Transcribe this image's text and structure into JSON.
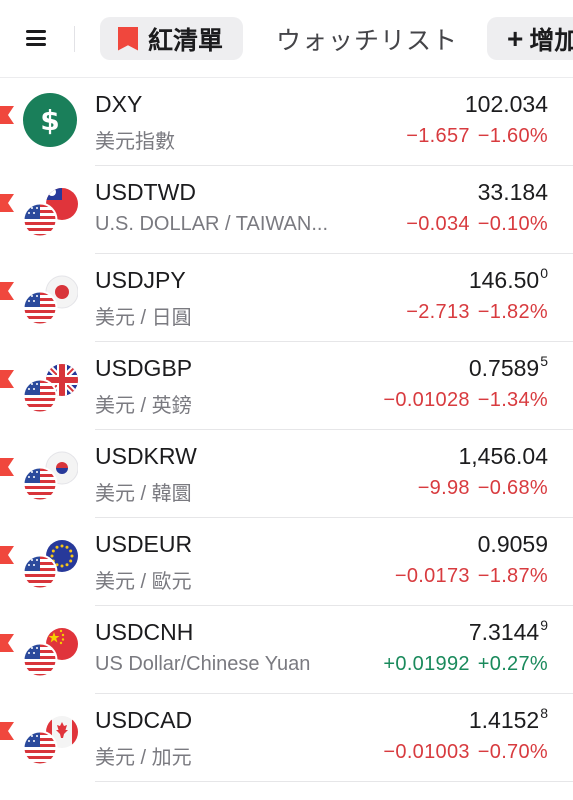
{
  "header": {
    "tabs": [
      {
        "label": "紅清單",
        "active": true
      },
      {
        "label": "ウォッチリスト",
        "active": false
      },
      {
        "label": "增加",
        "active": false
      }
    ]
  },
  "colors": {
    "accent": "#f0473d",
    "negative": "#d83b3f",
    "positive": "#1a8a5c"
  },
  "rows": [
    {
      "symbol": "DXY",
      "name": "美元指數",
      "price": "102.034",
      "price_sup": "",
      "change": "−1.657",
      "pct": "−1.60%",
      "direction": "down",
      "icon": "dollar-index-icon"
    },
    {
      "symbol": "USDTWD",
      "name": "U.S. DOLLAR / TAIWAN...",
      "price": "33.184",
      "price_sup": "",
      "change": "−0.034",
      "pct": "−0.10%",
      "direction": "down",
      "icon": "us-tw-flags-icon"
    },
    {
      "symbol": "USDJPY",
      "name": "美元 / 日圓",
      "price": "146.50",
      "price_sup": "0",
      "change": "−2.713",
      "pct": "−1.82%",
      "direction": "down",
      "icon": "us-jp-flags-icon"
    },
    {
      "symbol": "USDGBP",
      "name": "美元 / 英鎊",
      "price": "0.7589",
      "price_sup": "5",
      "change": "−0.01028",
      "pct": "−1.34%",
      "direction": "down",
      "icon": "us-gb-flags-icon"
    },
    {
      "symbol": "USDKRW",
      "name": "美元 / 韓圜",
      "price": "1,456.04",
      "price_sup": "",
      "change": "−9.98",
      "pct": "−0.68%",
      "direction": "down",
      "icon": "us-kr-flags-icon"
    },
    {
      "symbol": "USDEUR",
      "name": "美元 / 歐元",
      "price": "0.9059",
      "price_sup": "",
      "change": "−0.0173",
      "pct": "−1.87%",
      "direction": "down",
      "icon": "us-eu-flags-icon"
    },
    {
      "symbol": "USDCNH",
      "name": "US Dollar/Chinese Yuan",
      "price": "7.3144",
      "price_sup": "9",
      "change": "+0.01992",
      "pct": "+0.27%",
      "direction": "up",
      "icon": "us-cn-flags-icon"
    },
    {
      "symbol": "USDCAD",
      "name": "美元 / 加元",
      "price": "1.4152",
      "price_sup": "8",
      "change": "−0.01003",
      "pct": "−0.70%",
      "direction": "down",
      "icon": "us-ca-flags-icon"
    }
  ]
}
